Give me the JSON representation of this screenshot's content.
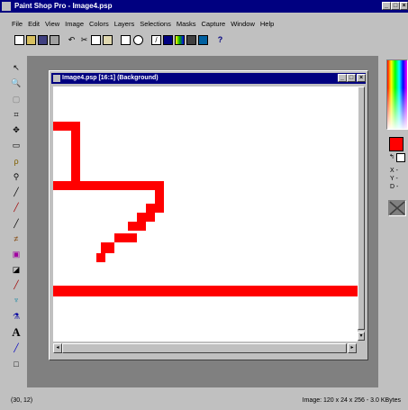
{
  "app": {
    "title": "Paint Shop Pro - Image4.psp",
    "menu": [
      "File",
      "Edit",
      "View",
      "Image",
      "Colors",
      "Layers",
      "Selections",
      "Masks",
      "Capture",
      "Window",
      "Help"
    ],
    "controls": {
      "minimize": "_",
      "maximize": "□",
      "close": "×"
    }
  },
  "document": {
    "title": "Image4.psp [16:1] (Background)"
  },
  "status": {
    "coords": "(30, 12)",
    "image_info": "Image: 120 x 24 x 256 - 3.0 KBytes"
  },
  "color_panel": {
    "readout_x": "X -",
    "readout_y": "Y -",
    "readout_d": "D -",
    "foreground": "#ff0000"
  },
  "tools": [
    "arrow-tool",
    "zoom-tool",
    "deform-tool",
    "crop-tool",
    "mover-tool",
    "selection-tool",
    "lasso-tool",
    "magic-wand-tool",
    "dropper-tool",
    "paintbrush-tool",
    "clone-brush-tool",
    "color-replacer-tool",
    "retouch-tool",
    "eraser-tool",
    "picture-tube-tool",
    "airbrush-tool",
    "flood-fill-tool",
    "text-tool",
    "line-tool",
    "shape-tool"
  ]
}
